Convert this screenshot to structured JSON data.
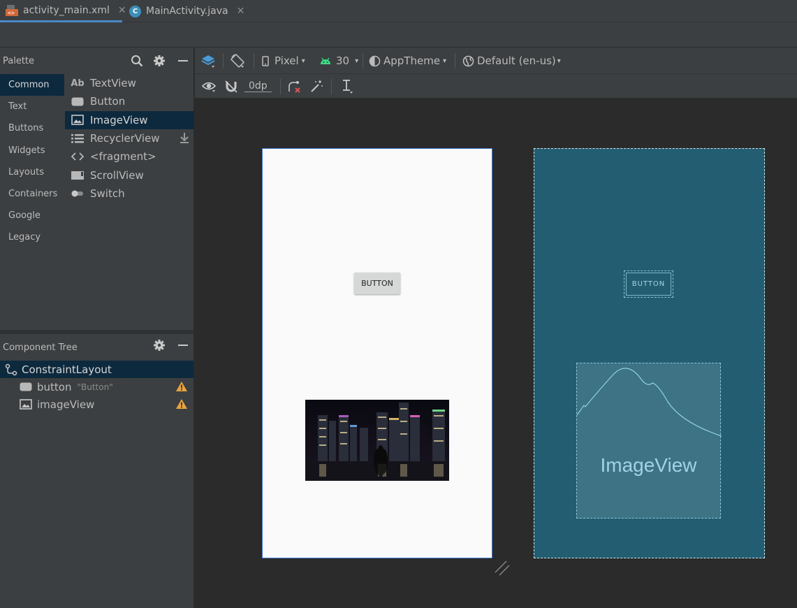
{
  "tabs": [
    {
      "label": "activity_main.xml",
      "active": true
    },
    {
      "label": "MainActivity.java",
      "active": false
    }
  ],
  "palette": {
    "title": "Palette",
    "categories": [
      "Common",
      "Text",
      "Buttons",
      "Widgets",
      "Layouts",
      "Containers",
      "Google",
      "Legacy"
    ],
    "selected_category": "Common",
    "widgets": [
      "TextView",
      "Button",
      "ImageView",
      "RecyclerView",
      "<fragment>",
      "ScrollView",
      "Switch"
    ],
    "selected_widget": "ImageView",
    "textview_icon_text": "Ab"
  },
  "component_tree": {
    "title": "Component Tree",
    "root": "ConstraintLayout",
    "children": [
      {
        "name": "button",
        "text": "\"Button\"",
        "warning": true
      },
      {
        "name": "imageView",
        "text": "",
        "warning": true
      }
    ]
  },
  "toolbar": {
    "device": "Pixel",
    "api": "30",
    "theme": "AppTheme",
    "locale": "Default (en-us)",
    "margin": "0dp"
  },
  "design": {
    "button_label": "BUTTON"
  },
  "blueprint": {
    "button_label": "BUTTON",
    "imageview_label": "ImageView"
  },
  "colors": {
    "accent": "#4a88c7",
    "selection": "#0d293e",
    "blueprint_bg": "#235d71",
    "warning": "#e8a33d",
    "android_green": "#3ddc84"
  }
}
